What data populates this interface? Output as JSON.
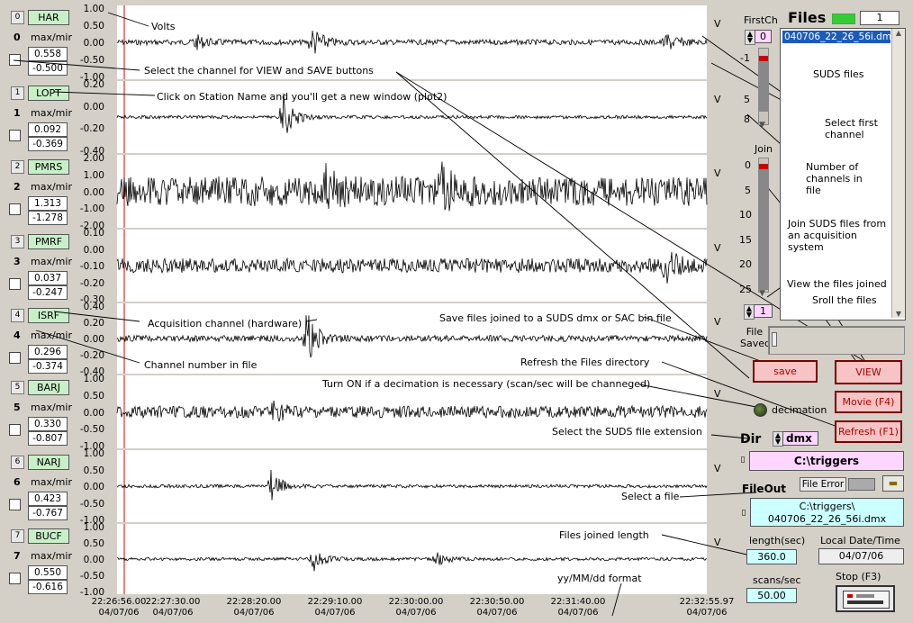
{
  "channels": [
    {
      "num": "0",
      "station": "HAR",
      "label": "max/min",
      "max": "0.558",
      "min": "-0.500",
      "ticks": [
        "1.00",
        "0.50",
        "0.00",
        "-0.50",
        "-1.00"
      ],
      "v": "V"
    },
    {
      "num": "1",
      "station": "LOPT",
      "label": "max/min",
      "max": "0.092",
      "min": "-0.369",
      "ticks": [
        "0.20",
        "0.00",
        "-0.20",
        "-0.40"
      ],
      "v": "V"
    },
    {
      "num": "2",
      "station": "PMRS",
      "label": "max/min",
      "max": "1.313",
      "min": "-1.278",
      "ticks": [
        "2.00",
        "1.00",
        "0.00",
        "-1.00",
        "-2.00"
      ],
      "v": "V"
    },
    {
      "num": "3",
      "station": "PMRF",
      "label": "max/min",
      "max": "0.037",
      "min": "-0.247",
      "ticks": [
        "0.10",
        "0.00",
        "-0.10",
        "-0.20",
        "-0.30"
      ],
      "v": "V"
    },
    {
      "num": "4",
      "station": "ISRF",
      "label": "max/min",
      "max": "0.296",
      "min": "-0.374",
      "ticks": [
        "0.40",
        "0.20",
        "0.00",
        "-0.20",
        "-0.40"
      ],
      "v": "V"
    },
    {
      "num": "5",
      "station": "BARJ",
      "label": "max/min",
      "max": "0.330",
      "min": "-0.807",
      "ticks": [
        "1.00",
        "0.50",
        "0.00",
        "-0.50",
        "-1.00"
      ],
      "v": "V"
    },
    {
      "num": "6",
      "station": "NARJ",
      "label": "max/min",
      "max": "0.423",
      "min": "-0.767",
      "ticks": [
        "1.00",
        "0.50",
        "0.00",
        "-0.50",
        "-1.00"
      ],
      "v": "V"
    },
    {
      "num": "7",
      "station": "BUCF",
      "label": "max/min",
      "max": "0.550",
      "min": "-0.616",
      "ticks": [
        "1.00",
        "0.50",
        "0.00",
        "-0.50",
        "-1.00"
      ],
      "v": "V"
    }
  ],
  "xaxis": [
    {
      "time": "22:26:56.00",
      "date": "04/07/06"
    },
    {
      "time": "22:27:30.00",
      "date": "04/07/06"
    },
    {
      "time": "22:28:20.00",
      "date": "04/07/06"
    },
    {
      "time": "22:29:10.00",
      "date": "04/07/06"
    },
    {
      "time": "22:30:00.00",
      "date": "04/07/06"
    },
    {
      "time": "22:30:50.00",
      "date": "04/07/06"
    },
    {
      "time": "22:31:40.00",
      "date": "04/07/06"
    },
    {
      "time": "22:32:55.97",
      "date": "04/07/06"
    }
  ],
  "annotations": {
    "volts": "Volts",
    "select_channel": "Select the channel for  VIEW and SAVE buttons",
    "click_station": "Click on Station Name and you'll get a new window (plot2)",
    "acq_channel": "Acquisition channel (hardware)",
    "save_files": "Save files joined to a SUDS dmx or SAC bin file",
    "channel_number": "Channel number in file",
    "refresh_dir": "Refresh the Files directory",
    "decimation_note": "Turn ON if a decimation is necessary (scan/sec will be channeged)",
    "select_ext": "Select the SUDS file extension",
    "select_file": "Select a file",
    "files_length": "Files joined length",
    "date_format": "yy/MM/dd format",
    "suds_files": "SUDS files",
    "select_first": "Select first channel",
    "num_channels": "Number of channels in file",
    "join_suds": "Join SUDS files from an acquisition system",
    "view_joined": "View the files joined",
    "scroll_files": "Sroll the files"
  },
  "right": {
    "firstch_label": "FirstCh",
    "firstch_value": "0",
    "firstch_scale": [
      "-1",
      "5",
      "8"
    ],
    "join_label": "Join",
    "join_scale": [
      "0",
      "5",
      "10",
      "15",
      "20",
      "25"
    ],
    "join_value": "1",
    "files_title": "Files",
    "files_count": "1",
    "files_list": [
      "040706_22_26_56i.dmx"
    ],
    "file_saved_label": "File Saved",
    "save_btn": "save",
    "view_btn": "VIEW",
    "movie_btn": "Movie (F4)",
    "refresh_btn": "Refresh (F1)",
    "decimation_label": "decimation",
    "dir_label": "Dir",
    "dir_value": "dmx",
    "path_value": "C:\\triggers",
    "file_error_label": "File Error",
    "fileout_label": "FileOut",
    "fileout_value_line1": "C:\\triggers\\",
    "fileout_value_line2": "040706_22_26_56i.dmx",
    "length_label": "length(sec)",
    "length_value": "360.0",
    "local_dt_label": "Local Date/Time",
    "local_dt_value": "04/07/06",
    "scans_label": "scans/sec",
    "scans_value": "50.00",
    "stop_label": "Stop (F3)"
  },
  "colors": {
    "station_bg": "#c8f0c8",
    "button_bg": "#f6c4c4",
    "magenta_field": "#ffd6ff",
    "cyan_field": "#ccffff",
    "led": "#33cc33"
  }
}
